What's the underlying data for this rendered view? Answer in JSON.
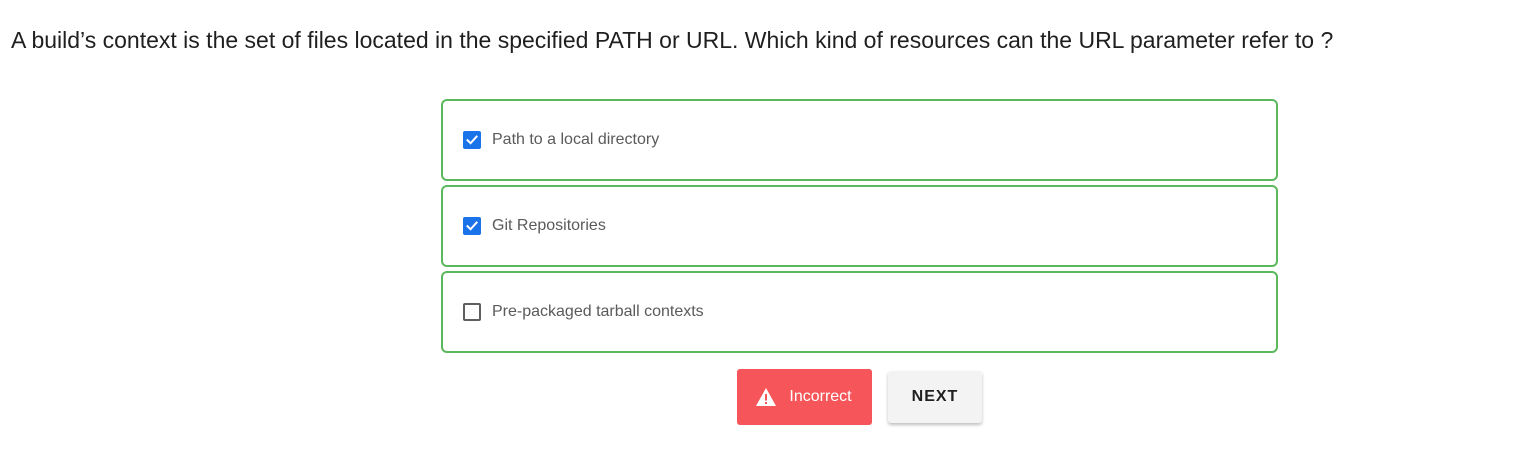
{
  "question": {
    "text": "A build’s context is the set of files located in the specified PATH or URL. Which kind of resources can the URL parameter refer to ?"
  },
  "options": [
    {
      "label": "Path to a local directory",
      "checked": true
    },
    {
      "label": "Git Repositories",
      "checked": true
    },
    {
      "label": "Pre-packaged tarball contexts",
      "checked": false
    }
  ],
  "result": {
    "label": "Incorrect",
    "icon": "warning-icon",
    "color": "#f6565a"
  },
  "next_button": {
    "label": "NEXT"
  },
  "colors": {
    "option_border": "#5cb85c",
    "checkbox_checked": "#1a73e8"
  }
}
